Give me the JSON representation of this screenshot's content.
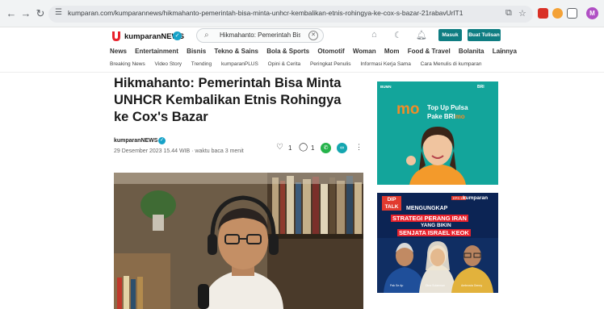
{
  "browser": {
    "url": "kumparan.com/kumparannews/hikmahanto-pemerintah-bisa-minta-unhcr-kembalikan-etnis-rohingya-ke-cox-s-bazar-21rabavUrlT1",
    "profile_initial": "M"
  },
  "site": {
    "brand": "kumparanNEWS",
    "search_value": "Hikmahanto: Pemerintah Bisa M",
    "login_label": "Masuk",
    "write_label": "Buat Tulisan",
    "categories": [
      "News",
      "Entertainment",
      "Bisnis",
      "Tekno & Sains",
      "Bola & Sports",
      "Otomotif",
      "Woman",
      "Mom",
      "Food & Travel",
      "Bolanita"
    ],
    "more_label": "Lainnya",
    "subnav": [
      "Breaking News",
      "Video Story",
      "Trending",
      "kumparanPLUS",
      "Opini & Cerita",
      "Peringkat Penulis",
      "Informasi Kerja Sama",
      "Cara Menulis di kumparan"
    ]
  },
  "article": {
    "title": "Hikmahanto: Pemerintah Bisa Minta UNHCR Kembalikan Etnis Rohingya ke Cox's Bazar",
    "author": "kumparanNEWS",
    "meta": "29 Desember 2023 15.44 WIB · waktu baca 3 menit",
    "likes": "1",
    "comments": "1"
  },
  "ads": {
    "ad1_brand": "BUMN",
    "ad1_bri": "BRI",
    "ad1_logo": "mo",
    "ad1_line1": "Top Up Pulsa",
    "ad1_line2_prefix": "Pake BRI",
    "ad1_line2_hl": "mo",
    "ad2_badge_top": "DIP",
    "ad2_badge_bottom": "TALK",
    "ad2_eps": "EPS 13",
    "ad2_brand": "kumparan",
    "ad2_line1": "MENGUNGKAP",
    "ad2_line2": "STRATEGI PERANG IRAN",
    "ad2_line3": "YANG BIKIN",
    "ad2_line4": "SENJATA ISRAEL KEOK",
    "ad2_guest1": "Pak Se Ap",
    "ad2_guest2": "Dina Sulaeman",
    "ad2_guest3": "Ambrosia Genny"
  },
  "colors": {
    "brand_teal": "#0f7d82",
    "verify_blue": "#16a2c8",
    "ad1_bg": "#13a59b",
    "ad2_bg": "#0c2454",
    "accent_orange": "#f28c28",
    "accent_red": "#e8222c"
  }
}
